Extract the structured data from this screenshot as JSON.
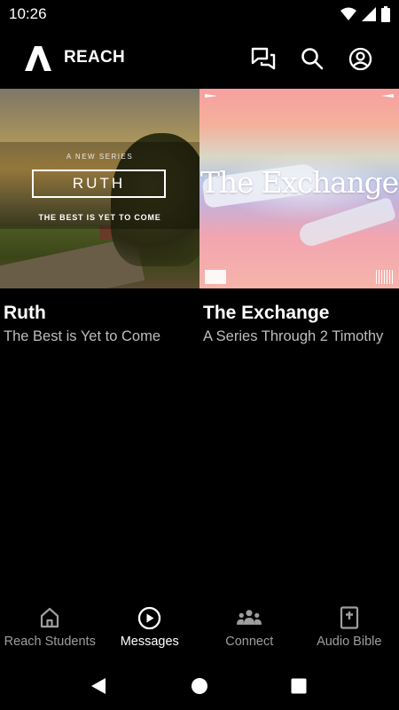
{
  "status_bar": {
    "time": "10:26"
  },
  "app_bar": {
    "title": "REACH"
  },
  "series": [
    {
      "title": "Ruth",
      "subtitle": "The Best is Yet to Come",
      "art": {
        "small_text": "A NEW SERIES",
        "main_text": "RUTH",
        "tagline": "THE BEST IS YET TO COME"
      }
    },
    {
      "title": "The Exchange",
      "subtitle": "A Series Through 2 Timothy",
      "art": {
        "main_text": "The Exchange"
      }
    }
  ],
  "bottom_nav": {
    "items": [
      {
        "label": "Reach Students",
        "icon": "home-icon",
        "active": false
      },
      {
        "label": "Messages",
        "icon": "play-circle-icon",
        "active": true
      },
      {
        "label": "Connect",
        "icon": "group-icon",
        "active": false
      },
      {
        "label": "Audio Bible",
        "icon": "bible-icon",
        "active": false
      }
    ]
  },
  "colors": {
    "background": "#000000",
    "text": "#ffffff",
    "secondary_text": "#bdbdbd",
    "inactive_nav": "#9e9e9e"
  }
}
